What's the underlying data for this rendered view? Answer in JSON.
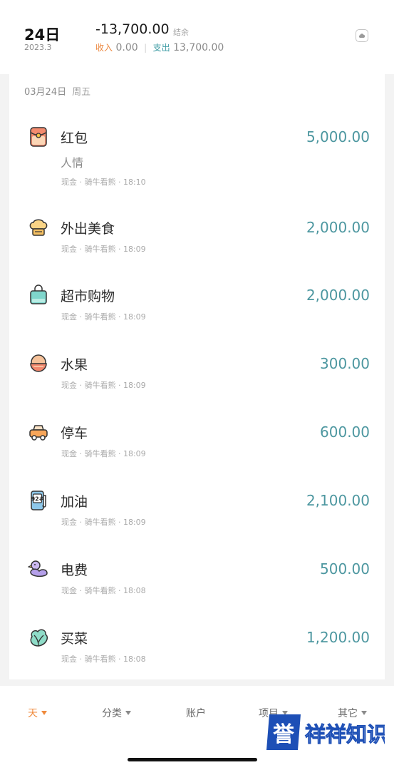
{
  "header": {
    "day": "24日",
    "month": "2023.3",
    "balance": "-13,700.00",
    "balance_label": "结余",
    "income_label": "收入",
    "income_value": "0.00",
    "expense_label": "支出",
    "expense_value": "13,700.00",
    "sync_icon": "cloud-sync-icon"
  },
  "day_group": {
    "date": "03月24日",
    "weekday": "周五"
  },
  "entries": [
    {
      "name": "红包",
      "note": "人情",
      "meta": "现金 · 骑牛看熊 · 18:10",
      "amount": "5,000.00",
      "icon": "red-envelope-icon"
    },
    {
      "name": "外出美食",
      "meta": "现金 · 骑牛看熊 · 18:09",
      "amount": "2,000.00",
      "icon": "chef-hat-icon"
    },
    {
      "name": "超市购物",
      "meta": "现金 · 骑牛看熊 · 18:09",
      "amount": "2,000.00",
      "icon": "shopping-bag-icon"
    },
    {
      "name": "水果",
      "meta": "现金 · 骑牛看熊 · 18:09",
      "amount": "300.00",
      "icon": "fruit-bowl-icon"
    },
    {
      "name": "停车",
      "meta": "现金 · 骑牛看熊 · 18:09",
      "amount": "600.00",
      "icon": "car-icon"
    },
    {
      "name": "加油",
      "meta": "现金 · 骑牛看熊 · 18:09",
      "amount": "2,100.00",
      "icon": "fuel-pump-icon",
      "icon_text": "92#"
    },
    {
      "name": "电费",
      "meta": "现金 · 骑牛看熊 · 18:08",
      "amount": "500.00",
      "icon": "duck-icon"
    },
    {
      "name": "买菜",
      "meta": "现金 · 骑牛看熊 · 18:08",
      "amount": "1,200.00",
      "icon": "vegetable-icon"
    }
  ],
  "nav": {
    "day": "天",
    "category": "分类",
    "account": "账户",
    "project": "项目",
    "other": "其它"
  },
  "watermark": {
    "text": "誉祥祥知识"
  },
  "colors": {
    "amount": "#4d97a0",
    "income": "#ec8840",
    "expense": "#3e9ca4",
    "active_nav": "#ef8a3c"
  }
}
